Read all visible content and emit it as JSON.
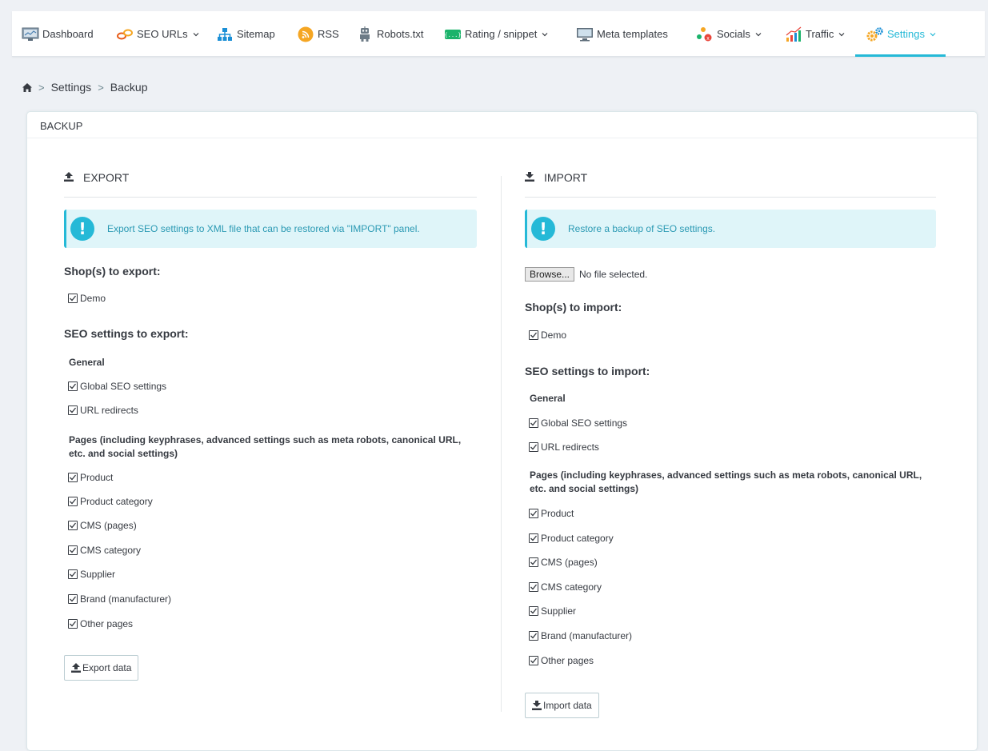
{
  "nav": {
    "items": [
      {
        "label": "Dashboard",
        "icon": "dashboard-icon",
        "dropdown": false
      },
      {
        "label": "SEO URLs",
        "icon": "link-icon",
        "dropdown": true
      },
      {
        "label": "Sitemap",
        "icon": "sitemap-icon",
        "dropdown": false
      },
      {
        "label": "RSS",
        "icon": "rss-icon",
        "dropdown": false
      },
      {
        "label": "Robots.txt",
        "icon": "robot-icon",
        "dropdown": false
      },
      {
        "label": "Rating / snippet",
        "icon": "snippet-icon",
        "dropdown": true
      },
      {
        "label": "Meta templates",
        "icon": "monitor-icon",
        "dropdown": false
      },
      {
        "label": "Socials",
        "icon": "socials-icon",
        "dropdown": true
      },
      {
        "label": "Traffic",
        "icon": "traffic-chart-icon",
        "dropdown": true
      },
      {
        "label": "Settings",
        "icon": "gears-icon",
        "dropdown": true,
        "active": true
      }
    ]
  },
  "breadcrumb": {
    "items": [
      "Settings",
      "Backup"
    ],
    "icon": "home-icon"
  },
  "panel": {
    "heading": "BACKUP"
  },
  "export": {
    "title": "EXPORT",
    "alert": "Export SEO settings to XML file that can be restored via \"IMPORT\" panel.",
    "shops_label": "Shop(s) to export:",
    "shops": [
      "Demo"
    ],
    "settings_label": "SEO settings to export:",
    "general_label": "General",
    "general_items": [
      "Global SEO settings",
      "URL redirects"
    ],
    "pages_label": "Pages (including keyphrases, advanced settings such as meta robots, canonical URL, etc. and social settings)",
    "page_items": [
      "Product",
      "Product category",
      "CMS (pages)",
      "CMS category",
      "Supplier",
      "Brand (manufacturer)",
      "Other pages"
    ],
    "button": "Export data"
  },
  "import": {
    "title": "IMPORT",
    "alert": "Restore a backup of SEO settings.",
    "browse_button": "Browse...",
    "file_status": "No file selected.",
    "shops_label": "Shop(s) to import:",
    "shops": [
      "Demo"
    ],
    "settings_label": "SEO settings to import:",
    "general_label": "General",
    "general_items": [
      "Global SEO settings",
      "URL redirects"
    ],
    "pages_label": "Pages (including keyphrases, advanced settings such as meta robots, canonical URL, etc. and social settings)",
    "page_items": [
      "Product",
      "Product category",
      "CMS (pages)",
      "CMS category",
      "Supplier",
      "Brand (manufacturer)",
      "Other pages"
    ],
    "button": "Import data"
  },
  "colors": {
    "accent": "#25b9d7",
    "alert_bg": "#dff5f9",
    "text": "#363a41"
  }
}
